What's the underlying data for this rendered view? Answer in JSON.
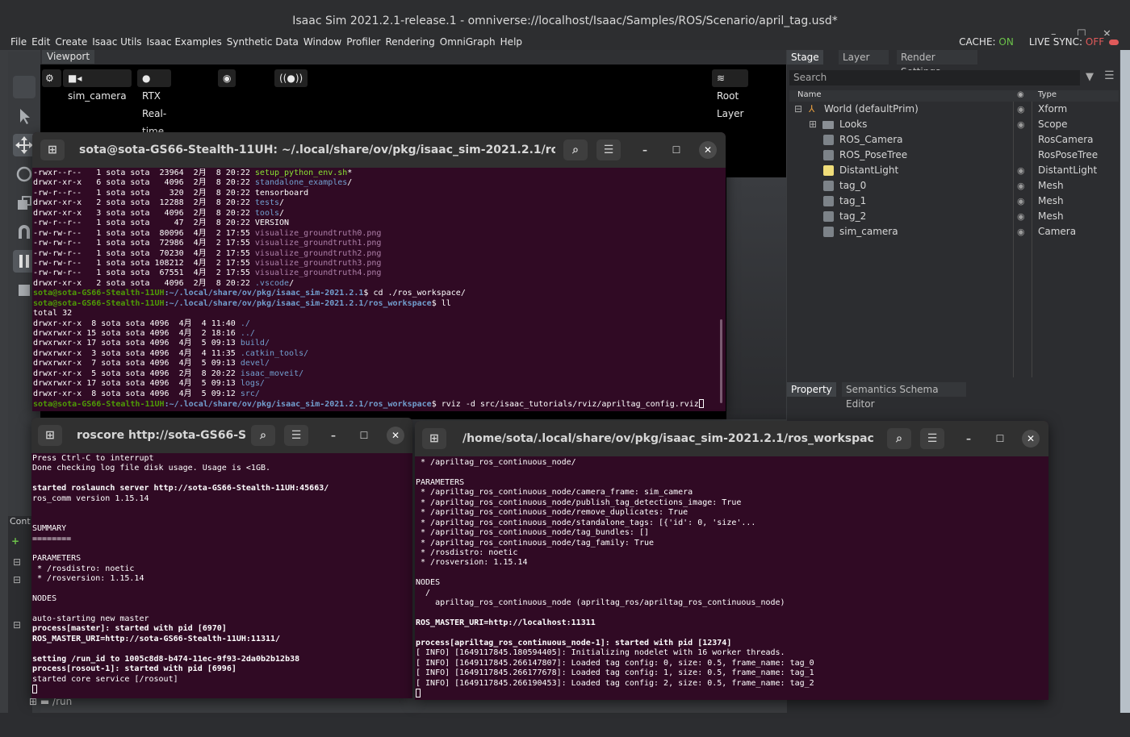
{
  "window": {
    "title": "Isaac Sim 2021.2.1-release.1 - omniverse://localhost/Isaac/Samples/ROS/Scenario/april_tag.usd*",
    "minimize": "–",
    "maximize": "☐",
    "close": "✕"
  },
  "menu": {
    "items": [
      "File",
      "Edit",
      "Create",
      "Isaac Utils",
      "Isaac Examples",
      "Synthetic Data",
      "Window",
      "Profiler",
      "Rendering",
      "OmniGraph",
      "Help"
    ],
    "cache_label": "CACHE:",
    "cache_value": "ON",
    "live_sync_label": "LIVE SYNC:",
    "live_sync_value": "OFF"
  },
  "viewport": {
    "tab": "Viewport",
    "camera": "sim_camera",
    "render_mode": "RTX Real-time",
    "root_layer": "Root Layer"
  },
  "stage": {
    "tabs": [
      "Stage",
      "Layer",
      "Render Settings"
    ],
    "search_placeholder": "Search",
    "col_name": "Name",
    "col_type": "Type",
    "rows": [
      {
        "name": "World (defaultPrim)",
        "type": "Xform"
      },
      {
        "name": "Looks",
        "type": "Scope"
      },
      {
        "name": "ROS_Camera",
        "type": "RosCamera"
      },
      {
        "name": "ROS_PoseTree",
        "type": "RosPoseTree"
      },
      {
        "name": "DistantLight",
        "type": "DistantLight"
      },
      {
        "name": "tag_0",
        "type": "Mesh"
      },
      {
        "name": "tag_1",
        "type": "Mesh"
      },
      {
        "name": "tag_2",
        "type": "Mesh"
      },
      {
        "name": "sim_camera",
        "type": "Camera"
      }
    ]
  },
  "property": {
    "tabs": [
      "Property",
      "Semantics Schema Editor"
    ]
  },
  "content": {
    "tab_fragment": "Cont",
    "run_path": "/run"
  },
  "term1": {
    "title": "sota@sota-GS66-Stealth-11UH: ~/.local/share/ov/pkg/isaac_sim-2021.2.1/ros_worksp...",
    "listing": [
      {
        "perm": "-rwxr--r--   1 sota sota  23964  2月  8 20:22 ",
        "name": "setup_python_env.sh",
        "cls": "exe",
        "suffix": "*"
      },
      {
        "perm": "drwxr-xr-x   6 sota sota   4096  2月  8 20:22 ",
        "name": "standalone_examples",
        "cls": "dirc",
        "suffix": "/"
      },
      {
        "perm": "-rw-r--r--   1 sota sota    320  2月  8 20:22 ",
        "name": "tensorboard",
        "cls": "",
        "suffix": ""
      },
      {
        "perm": "drwxr-xr-x   2 sota sota  12288  2月  8 20:22 ",
        "name": "tests",
        "cls": "dirc",
        "suffix": "/"
      },
      {
        "perm": "drwxr-xr-x   3 sota sota   4096  2月  8 20:22 ",
        "name": "tools",
        "cls": "dirc",
        "suffix": "/"
      },
      {
        "perm": "-rw-r--r--   1 sota sota     47  2月  8 20:22 ",
        "name": "VERSION",
        "cls": "",
        "suffix": ""
      },
      {
        "perm": "-rw-rw-r--   1 sota sota  80096  4月  2 17:55 ",
        "name": "visualize_groundtruth0.png",
        "cls": "img",
        "suffix": ""
      },
      {
        "perm": "-rw-rw-r--   1 sota sota  72986  4月  2 17:55 ",
        "name": "visualize_groundtruth1.png",
        "cls": "img",
        "suffix": ""
      },
      {
        "perm": "-rw-rw-r--   1 sota sota  70230  4月  2 17:55 ",
        "name": "visualize_groundtruth2.png",
        "cls": "img",
        "suffix": ""
      },
      {
        "perm": "-rw-rw-r--   1 sota sota 108212  4月  2 17:55 ",
        "name": "visualize_groundtruth3.png",
        "cls": "img",
        "suffix": ""
      },
      {
        "perm": "-rw-rw-r--   1 sota sota  67551  4月  2 17:55 ",
        "name": "visualize_groundtruth4.png",
        "cls": "img",
        "suffix": ""
      },
      {
        "perm": "drwxr-xr-x   2 sota sota   4096  2月  8 20:22 ",
        "name": ".vscode",
        "cls": "dirc",
        "suffix": "/"
      }
    ],
    "prompt_user": "sota@sota-GS66-Stealth-11UH",
    "prompt_path1": ":~/.local/share/ov/pkg/isaac_sim-2021.2.1",
    "cmd1": "$ cd ./ros_workspace/",
    "prompt_path2": ":~/.local/share/ov/pkg/isaac_sim-2021.2.1/ros_workspace",
    "cmd2": "$ ll",
    "total": "total 32",
    "listing2": [
      {
        "perm": "drwxr-xr-x  8 sota sota 4096  4月  4 11:40 ",
        "name": "./",
        "cls": "dirc"
      },
      {
        "perm": "drwxrwxr-x 15 sota sota 4096  4月  2 18:16 ",
        "name": "../",
        "cls": "dirc"
      },
      {
        "perm": "drwxrwxr-x 17 sota sota 4096  4月  5 09:13 ",
        "name": "build/",
        "cls": "dirc"
      },
      {
        "perm": "drwxrwxr-x  3 sota sota 4096  4月  4 11:35 ",
        "name": ".catkin_tools/",
        "cls": "dirc"
      },
      {
        "perm": "drwxrwxr-x  7 sota sota 4096  4月  5 09:13 ",
        "name": "devel/",
        "cls": "dirc"
      },
      {
        "perm": "drwxr-xr-x  5 sota sota 4096  2月  8 20:22 ",
        "name": "isaac_moveit/",
        "cls": "dirc"
      },
      {
        "perm": "drwxrwxr-x 17 sota sota 4096  4月  5 09:13 ",
        "name": "logs/",
        "cls": "dirc"
      },
      {
        "perm": "drwxr-xr-x  8 sota sota 4096  4月  5 09:12 ",
        "name": "src/",
        "cls": "dirc"
      }
    ],
    "cmd3": "$ rviz -d src/isaac_tutorials/rviz/apriltag_config.rviz"
  },
  "term2": {
    "title": "roscore http://sota-GS66-S...",
    "lines": [
      {
        "t": "Press Ctrl-C to interrupt",
        "b": false
      },
      {
        "t": "Done checking log file disk usage. Usage is <1GB.",
        "b": false
      },
      {
        "t": "",
        "b": false
      },
      {
        "t": "started roslaunch server http://sota-GS66-Stealth-11UH:45663/",
        "b": true
      },
      {
        "t": "ros_comm version 1.15.14",
        "b": false
      },
      {
        "t": "",
        "b": false
      },
      {
        "t": "",
        "b": false
      },
      {
        "t": "SUMMARY",
        "b": false
      },
      {
        "t": "========",
        "b": false
      },
      {
        "t": "",
        "b": false
      },
      {
        "t": "PARAMETERS",
        "b": false
      },
      {
        "t": " * /rosdistro: noetic",
        "b": false
      },
      {
        "t": " * /rosversion: 1.15.14",
        "b": false
      },
      {
        "t": "",
        "b": false
      },
      {
        "t": "NODES",
        "b": false
      },
      {
        "t": "",
        "b": false
      },
      {
        "t": "auto-starting new master",
        "b": false
      },
      {
        "t": "process[master]: started with pid [6970]",
        "b": true
      },
      {
        "t": "ROS_MASTER_URI=http://sota-GS66-Stealth-11UH:11311/",
        "b": true
      },
      {
        "t": "",
        "b": false
      },
      {
        "t": "setting /run_id to 1005c8d8-b474-11ec-9f93-2da0b2b12b38",
        "b": true
      },
      {
        "t": "process[rosout-1]: started with pid [6996]",
        "b": true
      },
      {
        "t": "started core service [/rosout]",
        "b": false
      }
    ]
  },
  "term3": {
    "title": "/home/sota/.local/share/ov/pkg/isaac_sim-2021.2.1/ros_workspace/src/is...",
    "lines": [
      {
        "t": " * /apriltag_ros_continuous_node/",
        "b": false
      },
      {
        "t": "",
        "b": false
      },
      {
        "t": "PARAMETERS",
        "b": false
      },
      {
        "t": " * /apriltag_ros_continuous_node/camera_frame: sim_camera",
        "b": false
      },
      {
        "t": " * /apriltag_ros_continuous_node/publish_tag_detections_image: True",
        "b": false
      },
      {
        "t": " * /apriltag_ros_continuous_node/remove_duplicates: True",
        "b": false
      },
      {
        "t": " * /apriltag_ros_continuous_node/standalone_tags: [{'id': 0, 'size'...",
        "b": false
      },
      {
        "t": " * /apriltag_ros_continuous_node/tag_bundles: []",
        "b": false
      },
      {
        "t": " * /apriltag_ros_continuous_node/tag_family: True",
        "b": false
      },
      {
        "t": " * /rosdistro: noetic",
        "b": false
      },
      {
        "t": " * /rosversion: 1.15.14",
        "b": false
      },
      {
        "t": "",
        "b": false
      },
      {
        "t": "NODES",
        "b": false
      },
      {
        "t": "  /",
        "b": false
      },
      {
        "t": "    apriltag_ros_continuous_node (apriltag_ros/apriltag_ros_continuous_node)",
        "b": false
      },
      {
        "t": "",
        "b": false
      },
      {
        "t": "ROS_MASTER_URI=http://localhost:11311",
        "b": true
      },
      {
        "t": "",
        "b": false
      },
      {
        "t": "process[apriltag_ros_continuous_node-1]: started with pid [12374]",
        "b": true
      },
      {
        "t": "[ INFO] [1649117845.180594405]: Initializing nodelet with 16 worker threads.",
        "b": false
      },
      {
        "t": "[ INFO] [1649117845.266147807]: Loaded tag config: 0, size: 0.5, frame_name: tag_0",
        "b": false
      },
      {
        "t": "[ INFO] [1649117845.266177678]: Loaded tag config: 1, size: 0.5, frame_name: tag_1",
        "b": false
      },
      {
        "t": "[ INFO] [1649117845.266190453]: Loaded tag config: 2, size: 0.5, frame_name: tag_2",
        "b": false
      }
    ]
  }
}
